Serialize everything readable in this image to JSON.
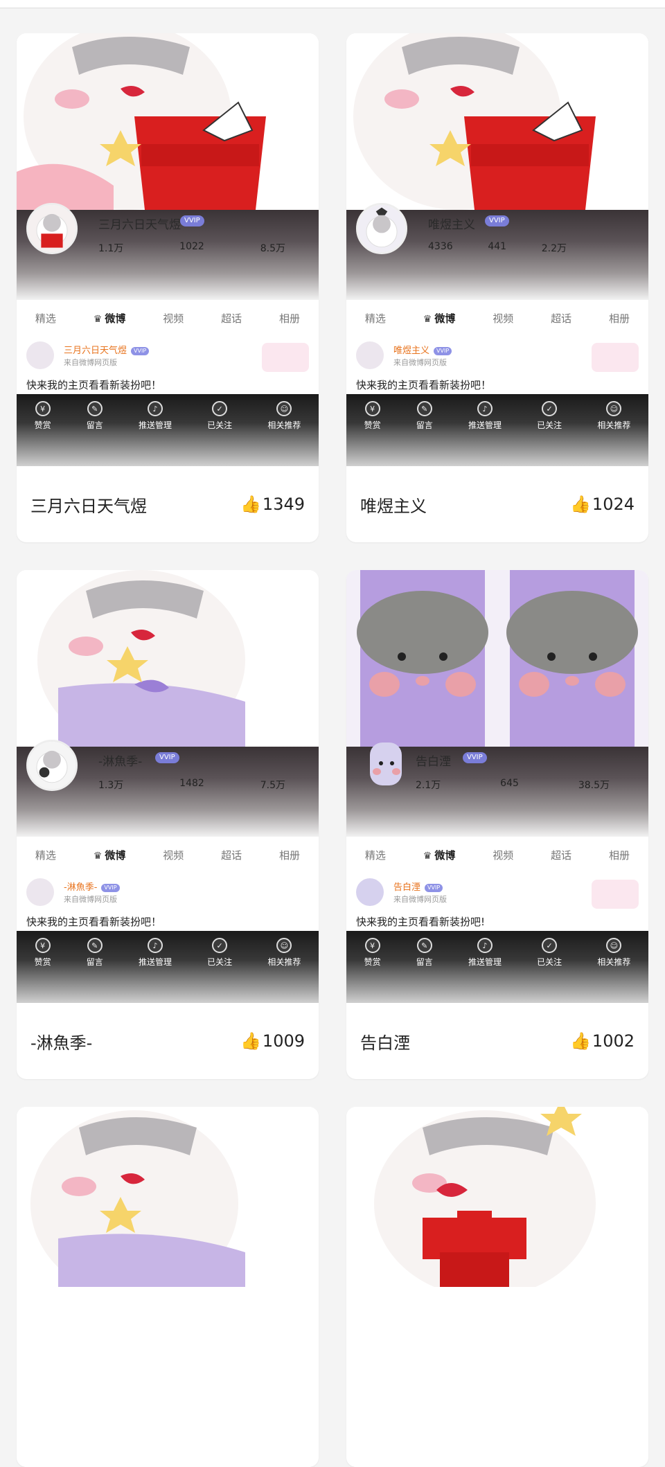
{
  "colors": {
    "orange": "#e8731d",
    "like": "#f06a2b",
    "vip": "#7a7dd8"
  },
  "icons": {
    "like": "thumbs-up-icon"
  },
  "cards": [
    {
      "hero_name": "三月六日天气煜",
      "vip": "VVIP",
      "stats": [
        "1.1万",
        "1022",
        "8.5万"
      ],
      "tabs": [
        "精选",
        "微博",
        "视频",
        "超话",
        "相册"
      ],
      "post_name": "三月六日天气煜",
      "post_source": "来自微博网页版",
      "post_text": "快来我的主页看看新装扮吧！",
      "actions": [
        "赞赏",
        "留言",
        "推送管理",
        "已关注",
        "相关推荐"
      ],
      "title": "三月六日天气煜",
      "likes": "1349"
    },
    {
      "hero_name": "唯煜主义",
      "vip": "VVIP",
      "stats": [
        "4336",
        "441",
        "2.2万"
      ],
      "tabs": [
        "精选",
        "微博",
        "视频",
        "超话",
        "相册"
      ],
      "post_name": "唯煜主义",
      "post_source": "来自微博网页版",
      "post_text": "快来我的主页看看新装扮吧！",
      "actions": [
        "赞赏",
        "留言",
        "推送管理",
        "已关注",
        "相关推荐"
      ],
      "title": "唯煜主义",
      "likes": "1024"
    },
    {
      "hero_name": "-淋魚季-",
      "vip": "VVIP",
      "stats": [
        "1.3万",
        "1482",
        "7.5万"
      ],
      "tabs": [
        "精选",
        "微博",
        "视频",
        "超话",
        "相册"
      ],
      "post_name": "-淋魚季-",
      "post_source": "来自微博网页版",
      "post_text": "快来我的主页看看新装扮吧！",
      "actions": [
        "赞赏",
        "留言",
        "推送管理",
        "已关注",
        "相关推荐"
      ],
      "title": "-淋魚季-",
      "likes": "1009"
    },
    {
      "hero_name": "告白湮",
      "vip": "VVIP",
      "stats": [
        "2.1万",
        "645",
        "38.5万"
      ],
      "tabs": [
        "精选",
        "微博",
        "视频",
        "超话",
        "相册"
      ],
      "post_name": "告白湮",
      "post_source": "来自微博网页版",
      "post_text": "快来我的主页看看新装扮吧!",
      "actions": [
        "赞赏",
        "留言",
        "推送管理",
        "已关注",
        "相关推荐"
      ],
      "title": "告白湮",
      "likes": "1002"
    }
  ]
}
